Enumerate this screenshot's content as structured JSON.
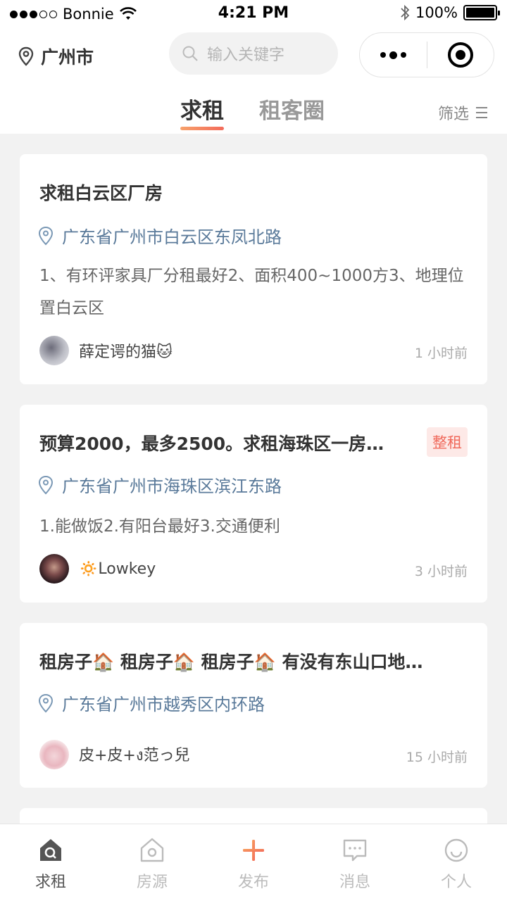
{
  "status_bar": {
    "carrier": "Bonnie",
    "time": "4:21 PM",
    "battery": "100%",
    "battery_level": 1.0
  },
  "header": {
    "city": "广州市",
    "search_placeholder": "输入关键字",
    "tabs": [
      {
        "label": "求租",
        "active": true
      },
      {
        "label": "租客圈",
        "active": false
      }
    ],
    "filter_label": "筛选"
  },
  "cards": [
    {
      "title": "求租白云区厂房",
      "badge": "",
      "location": "广东省广州市白云区东凤北路",
      "description": "1、有环评家具厂分租最好2、面积400~1000方3、地理位置白云区",
      "user": "薛定谔的猫🐱",
      "time": "1 小时前"
    },
    {
      "title": "预算2000，最多2500。求租海珠区一房…",
      "badge": "整租",
      "location": "广东省广州市海珠区滨江东路",
      "description": "1.能做饭2.有阳台最好3.交通便利",
      "user": "🔅Lowkey",
      "time": "3 小时前"
    },
    {
      "title": "租房子🏠 租房子🏠 租房子🏠 有没有东山口地…",
      "badge": "",
      "location": "广东省广州市越秀区内环路",
      "description": "",
      "user": "皮+皮+ง范っ兒",
      "time": "15 小时前"
    }
  ],
  "bottom_nav": [
    {
      "label": "求租",
      "icon": "search-home-icon",
      "active": true
    },
    {
      "label": "房源",
      "icon": "home-icon",
      "active": false
    },
    {
      "label": "发布",
      "icon": "plus-icon",
      "active": false
    },
    {
      "label": "消息",
      "icon": "chat-icon",
      "active": false
    },
    {
      "label": "个人",
      "icon": "smile-icon",
      "active": false
    }
  ],
  "colors": {
    "accent": "#f36b5b",
    "location_text": "#5a7a9a",
    "badge_bg": "#fde9e7"
  }
}
